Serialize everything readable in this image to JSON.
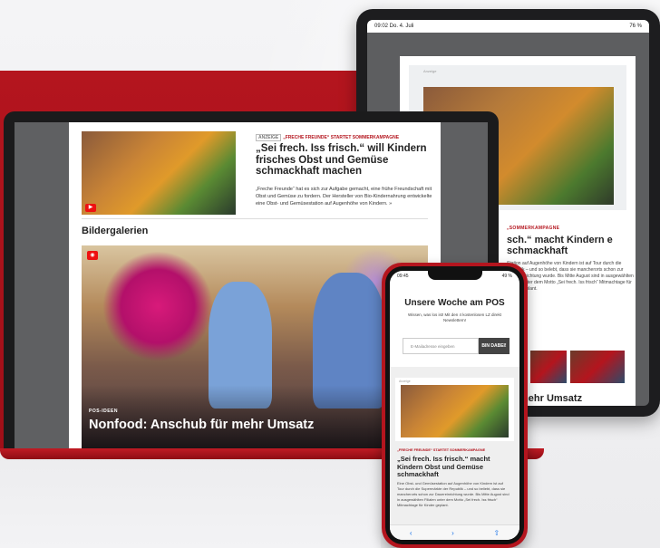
{
  "tablet": {
    "status_left": "09:02  Do. 4. Juli",
    "status_right": "76 %",
    "ad_label": "Anzeige",
    "kicker": "„SOMMERKAMPAGNE",
    "headline": "sch.“ macht Kindern e schmackhaft",
    "body": "Station auf Augenhöhe von Kindern ist auf Tour durch die Republik – und so belebt, dass sie mancherorts schon zur Dauereinrichtung wurde. Bis Mitte August sind in ausgewählten Filialen unter dem Motto „Sei frech. Iss frisch“ Mitmachtage für Kinder geplant.",
    "bottom_headline": "mehr Umsatz"
  },
  "laptop": {
    "tag": "ANZEIGE",
    "kicker": "„FRECHE FREUNDE“ STARTET SOMMERKAMPAGNE",
    "headline": "„Sei frech. Iss frisch.“ will Kindern frisches Obst und Gemüse schmackhaft machen",
    "body": "„Freche Freunde“ hat es sich zur Aufgabe gemacht, eine frühe Freundschaft mit Obst und Gemüse zu fordern. Der Hersteller von Bio-Kindernahrung entwickelte eine Obst- und Gemüsestation auf Augenhöhe von Kindern. »",
    "section_title": "Bildergalerien",
    "gallery_kicker": "POS-IDEEN",
    "gallery_title": "Nonfood: Anschub für mehr Umsatz"
  },
  "phone": {
    "status_left": "09:45",
    "status_right": "49 %",
    "title": "Unsere Woche am POS",
    "subtitle": "Wissen, was los ist! Mit den 4 kostenlosen LZ direkt Newslettern!",
    "email_placeholder": "E-Mailadresse eingeben",
    "subscribe_label": "BIN DABEI!",
    "ad_label": "Anzeige",
    "kicker": "„FRECHE FREUNDE“ STARTET SOMMERKAMPAGNE",
    "headline": "„Sei frech. Iss frisch.“ macht Kindern Obst und Gemüse schmackhaft",
    "body": "Eine Obst- und Gemüsestation auf Augenhöhe von Kindern ist auf Tour durch die Supermärkte der Republik – und so beliebt, dass sie mancherorts schon zur Dauereinrichtung wurde. Bis Mitte August sind in ausgewählten Filialen unter dem Motto „Sei frech. Iss frisch“ Mitmachtage für Kinder geplant."
  },
  "icons": {
    "play": "play-icon",
    "gallery": "gallery-icon",
    "back": "back-icon",
    "forward": "forward-icon",
    "share": "share-icon"
  },
  "colors": {
    "brand_red": "#b4151e"
  }
}
